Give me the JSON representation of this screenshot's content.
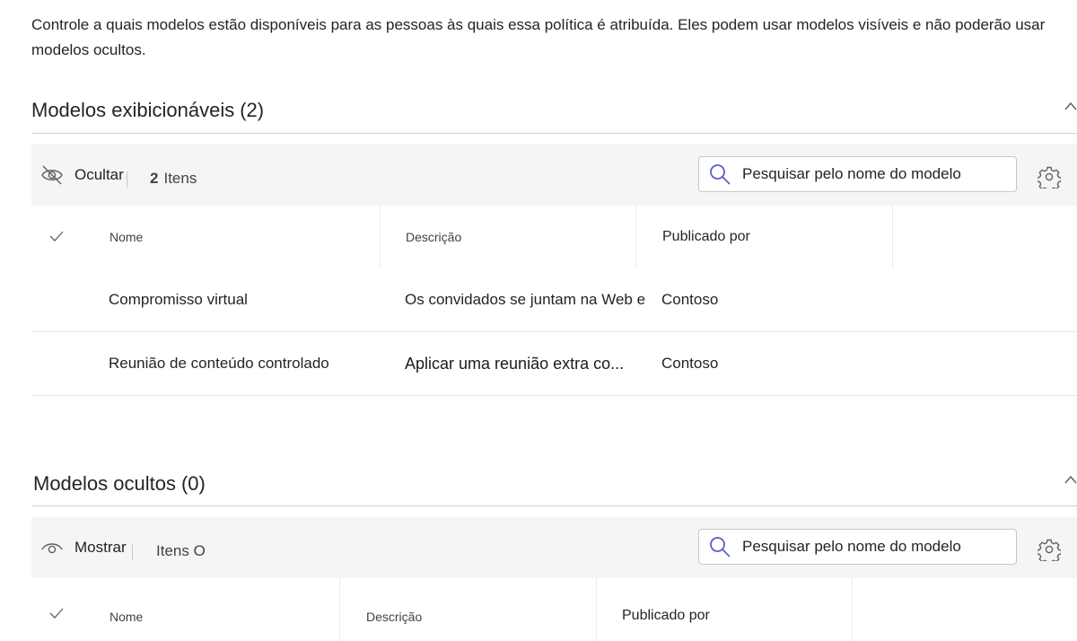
{
  "intro_text": "Controle a quais modelos estão disponíveis para as pessoas às quais essa política é atribuída. Eles podem usar modelos visíveis e não poderão usar modelos ocultos.",
  "visible_section": {
    "title": "Modelos exibicionáveis",
    "count": "(2)",
    "toolbar": {
      "action_label": "Ocultar",
      "action_icon": "eye-off-icon",
      "count_number": "2",
      "count_label": "Itens"
    },
    "search_placeholder": "Pesquisar pelo nome do modelo",
    "columns": {
      "name": "Nome",
      "description": "Descrição",
      "published_by": "Publicado por"
    },
    "rows": [
      {
        "name": "Compromisso virtual",
        "description": "Os convidados se juntam na Web e .",
        "published_by": "Contoso"
      },
      {
        "name": "Reunião de conteúdo controlado",
        "description": "Aplicar uma reunião extra co...",
        "published_by": "Contoso"
      }
    ]
  },
  "hidden_section": {
    "title": "Modelos ocultos",
    "count": "(0)",
    "toolbar": {
      "action_label": "Mostrar",
      "action_icon": "eye-icon",
      "count_label": "Itens O"
    },
    "search_placeholder": "Pesquisar pelo nome do modelo",
    "columns": {
      "name": "Nome",
      "description": "Descrição",
      "published_by": "Publicado por"
    }
  },
  "colors": {
    "toolbar_bg": "#f5f5f5",
    "search_icon": "#5b5fc7",
    "text": "#242424",
    "divider": "#d1d1d1"
  }
}
